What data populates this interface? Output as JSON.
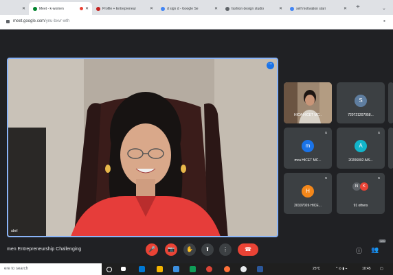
{
  "browser": {
    "tabs": [
      {
        "label": "Meet - k-women",
        "active": true,
        "recording": true
      },
      {
        "label": "Profile + Entrepreneur",
        "active": false
      },
      {
        "label": "d sign d - Google Se",
        "active": false
      },
      {
        "label": "fashion design studio",
        "active": false
      },
      {
        "label": "self motivation stari",
        "active": false
      }
    ],
    "new_tab_label": "+",
    "url_host": "meet.google.com",
    "url_path": "/ynu-bxvr-wth"
  },
  "main_video": {
    "name": "abel",
    "more_label": "⋯"
  },
  "participants": [
    {
      "name": "HICA HICET MC..",
      "initial": "",
      "avatar_color": "#8e7a66",
      "type": "photo"
    },
    {
      "name": "720721207058...",
      "initial": "S",
      "avatar_color": "#5f7ea0",
      "type": "avatar"
    },
    {
      "name": "mca HICET MC...",
      "initial": "m",
      "avatar_color": "#1a73e8",
      "type": "avatar"
    },
    {
      "name": "20206002 AIS...",
      "initial": "A",
      "avatar_color": "#12b5cb",
      "type": "avatar"
    },
    {
      "name": "20107026 HICE...",
      "initial": "H",
      "avatar_color": "#f4871a",
      "type": "avatar"
    },
    {
      "name": "91 others",
      "initial": "",
      "avatar_color": "#5f6368",
      "type": "others"
    }
  ],
  "others_avatars": [
    {
      "initial": "N",
      "color": "#5f6368"
    },
    {
      "initial": "K",
      "color": "#ea4335"
    }
  ],
  "meeting_title": "men Entrepreneurship Challenging",
  "controls": {
    "mic": "🎤",
    "camera": "📷",
    "hand": "✋",
    "present": "⬆",
    "more": "⋮",
    "hangup": "☎"
  },
  "right_controls": {
    "info": "ⓘ",
    "people": "👥",
    "people_badge": "100"
  },
  "taskbar": {
    "search_placeholder": "ere to search",
    "weather": "25°C",
    "time": "10:45"
  }
}
